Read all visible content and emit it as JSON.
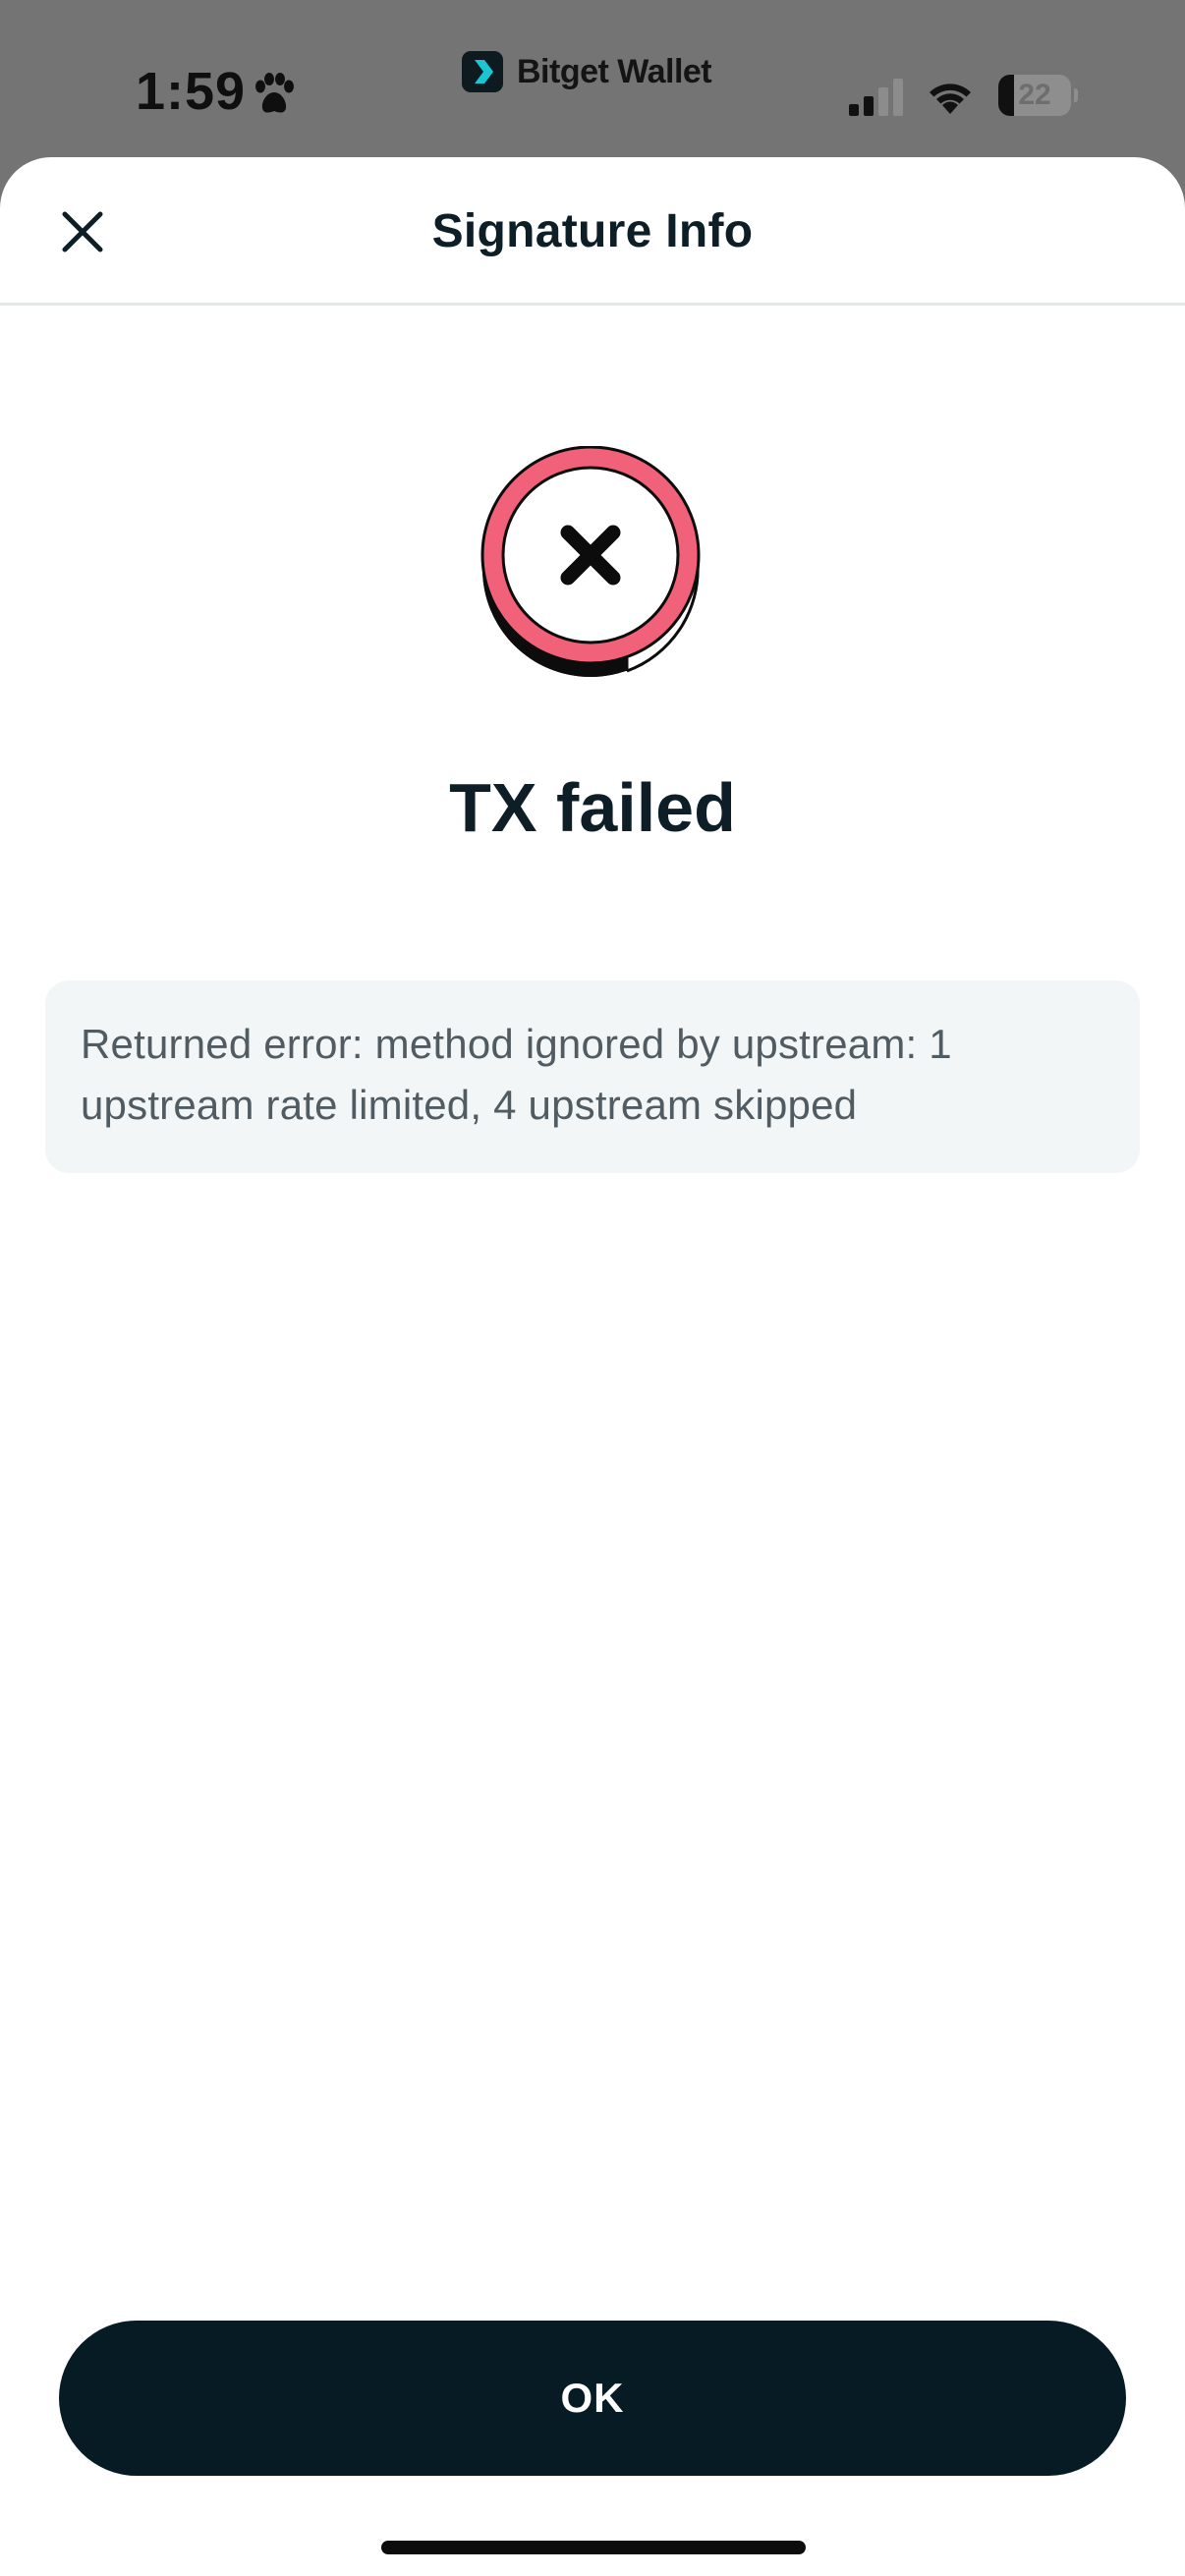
{
  "status_bar": {
    "time": "1:59",
    "app_indicator": "Bitget Wallet",
    "battery_percent": "22",
    "battery_level": 0.22
  },
  "sheet": {
    "title": "Signature Info",
    "close_icon": "close-icon"
  },
  "result": {
    "icon": "error-x-icon",
    "title": "TX failed",
    "error_message": "Returned error: method ignored by upstream: 1 upstream rate limited, 4 upstream skipped"
  },
  "actions": {
    "ok_label": "OK"
  },
  "colors": {
    "accent_fail": "#f1627a",
    "primary_button": "#061b24",
    "title_text": "#0d1e26",
    "error_box_bg": "#f3f6f7"
  }
}
